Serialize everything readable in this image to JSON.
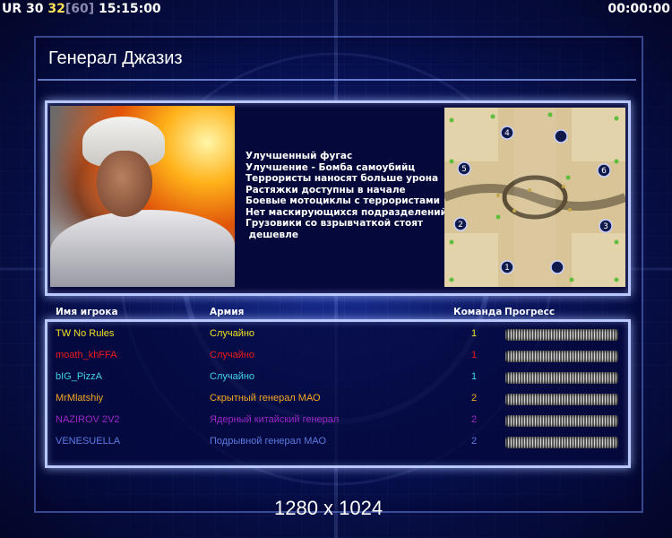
{
  "hud": {
    "seg1": "UR",
    "seg2": "30",
    "seg3": "32",
    "seg4": "[60]",
    "seg5": "15:15:00",
    "timer": "00:00:00"
  },
  "general": {
    "title": "Генерал Джазиз",
    "bonuses": [
      "Улучшенный фугас",
      "Улучшение - Бомба самоубийц",
      "Террористы наносят больше урона",
      "Растяжки доступны в начале",
      "Боевые мотоциклы с террористами",
      "Нет маскирующихся подразделений",
      "Грузовики со взрывчаткой стоят",
      " дешевле"
    ]
  },
  "map": {
    "start_positions": [
      "1",
      "2",
      "3",
      "4",
      "5",
      "6"
    ]
  },
  "table": {
    "headers": {
      "player": "Имя игрока",
      "army": "Армия",
      "team": "Команда",
      "progress": "Прогресс"
    },
    "players": [
      {
        "name": "TW No Rules",
        "army": "Случайно",
        "team": "1",
        "color": "#f0e020",
        "progress": 1.0
      },
      {
        "name": "moath_khFFA",
        "army": "Случайно",
        "team": "1",
        "color": "#ee1a1a",
        "progress": 1.0
      },
      {
        "name": "bIG_PizzA",
        "army": "Случайно",
        "team": "1",
        "color": "#3fd6e8",
        "progress": 1.0
      },
      {
        "name": "MrMlatshiy",
        "army": "Скрытный генерал МАО",
        "team": "2",
        "color": "#f5a81f",
        "progress": 1.0
      },
      {
        "name": "NAZIROV 2V2",
        "army": "Ядерный китайский генерал",
        "team": "2",
        "color": "#9b28c6",
        "progress": 1.0
      },
      {
        "name": "VENESUELLA",
        "army": "Подрывной генерал МАО",
        "team": "2",
        "color": "#5b7be0",
        "progress": 1.0
      }
    ]
  },
  "resolution": "1280 x 1024"
}
